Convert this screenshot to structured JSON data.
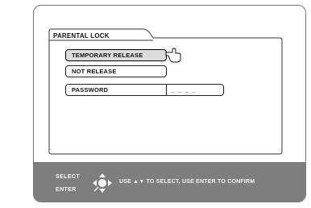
{
  "panel": {
    "title": "PARENTAL LOCK"
  },
  "menu": {
    "items": [
      {
        "label": "TEMPORARY RELEASE",
        "selected": true
      },
      {
        "label": "NOT RELEASE",
        "selected": false
      },
      {
        "label": "PASSWORD",
        "selected": false
      }
    ],
    "password_value": "_ _ _ _"
  },
  "footer": {
    "select_label": "SELECT",
    "enter_label": "ENTER",
    "instruction_prefix": "USE",
    "instruction_arrows": "▲▼",
    "instruction_suffix": "TO SELECT, USE ENTER TO CONFIRM"
  },
  "colors": {
    "footer_bg": "#7e7e7e",
    "selected_bg": "#dcdcdc"
  },
  "icons": {
    "pointer": "hand-pointer-icon",
    "nav": "directional-pad-icon"
  }
}
